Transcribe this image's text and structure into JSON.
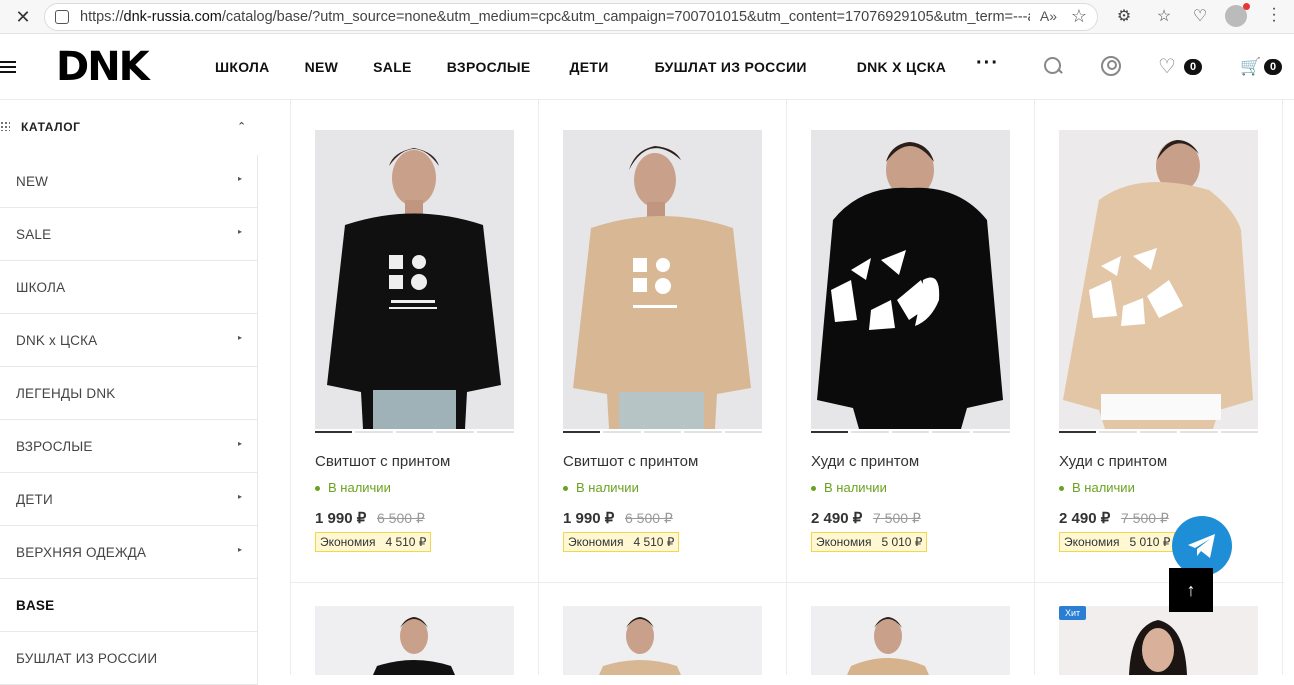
{
  "browser": {
    "url_host": "dnk-russia.com",
    "url_prefix": "https://",
    "url_rest": "/catalog/base/?utm_source=none&utm_medium=cpc&utm_campaign=700701015&utm_content=17076929105&utm_term=---a..."
  },
  "header": {
    "logo": "DNK",
    "nav": [
      "ШКОЛА",
      "NEW",
      "SALE",
      "ВЗРОСЛЫЕ",
      "ДЕТИ",
      "БУШЛАТ ИЗ РОССИИ",
      "DNK X ЦСКА"
    ],
    "more": "···",
    "wishlist_count": "0",
    "cart_count": "0"
  },
  "sidebar": {
    "title": "КАТАЛОГ",
    "items": [
      {
        "label": "NEW",
        "arrow": "▸"
      },
      {
        "label": "SALE",
        "arrow": "▸"
      },
      {
        "label": "ШКОЛА",
        "arrow": ""
      },
      {
        "label": "DNK x ЦСКА",
        "arrow": "▸"
      },
      {
        "label": "ЛЕГЕНДЫ DNK",
        "arrow": ""
      },
      {
        "label": "ВЗРОСЛЫЕ",
        "arrow": "▸"
      },
      {
        "label": "ДЕТИ",
        "arrow": "▸"
      },
      {
        "label": "ВЕРХНЯЯ ОДЕЖДА",
        "arrow": "▸"
      },
      {
        "label": "BASE",
        "arrow": ""
      },
      {
        "label": "БУШЛАТ ИЗ РОССИИ",
        "arrow": ""
      }
    ]
  },
  "products": [
    {
      "title": "Свитшот с принтом",
      "stock": "В наличии",
      "price": "1 990 ₽",
      "old_price": "6 500 ₽",
      "save_label": "Экономия",
      "save_value": "4 510 ₽"
    },
    {
      "title": "Свитшот с принтом",
      "stock": "В наличии",
      "price": "1 990 ₽",
      "old_price": "6 500 ₽",
      "save_label": "Экономия",
      "save_value": "4 510 ₽"
    },
    {
      "title": "Худи с принтом",
      "stock": "В наличии",
      "price": "2 490 ₽",
      "old_price": "7 500 ₽",
      "save_label": "Экономия",
      "save_value": "5 010 ₽"
    },
    {
      "title": "Худи с принтом",
      "stock": "В наличии",
      "price": "2 490 ₽",
      "old_price": "7 500 ₽",
      "save_label": "Экономия",
      "save_value": "5 010 ₽"
    }
  ],
  "second_row": {
    "hit_badge": "Хит"
  },
  "colors": {
    "accent_green": "#6aa21f",
    "telegram": "#1e8fd6",
    "save_bg": "#fff8d3"
  }
}
